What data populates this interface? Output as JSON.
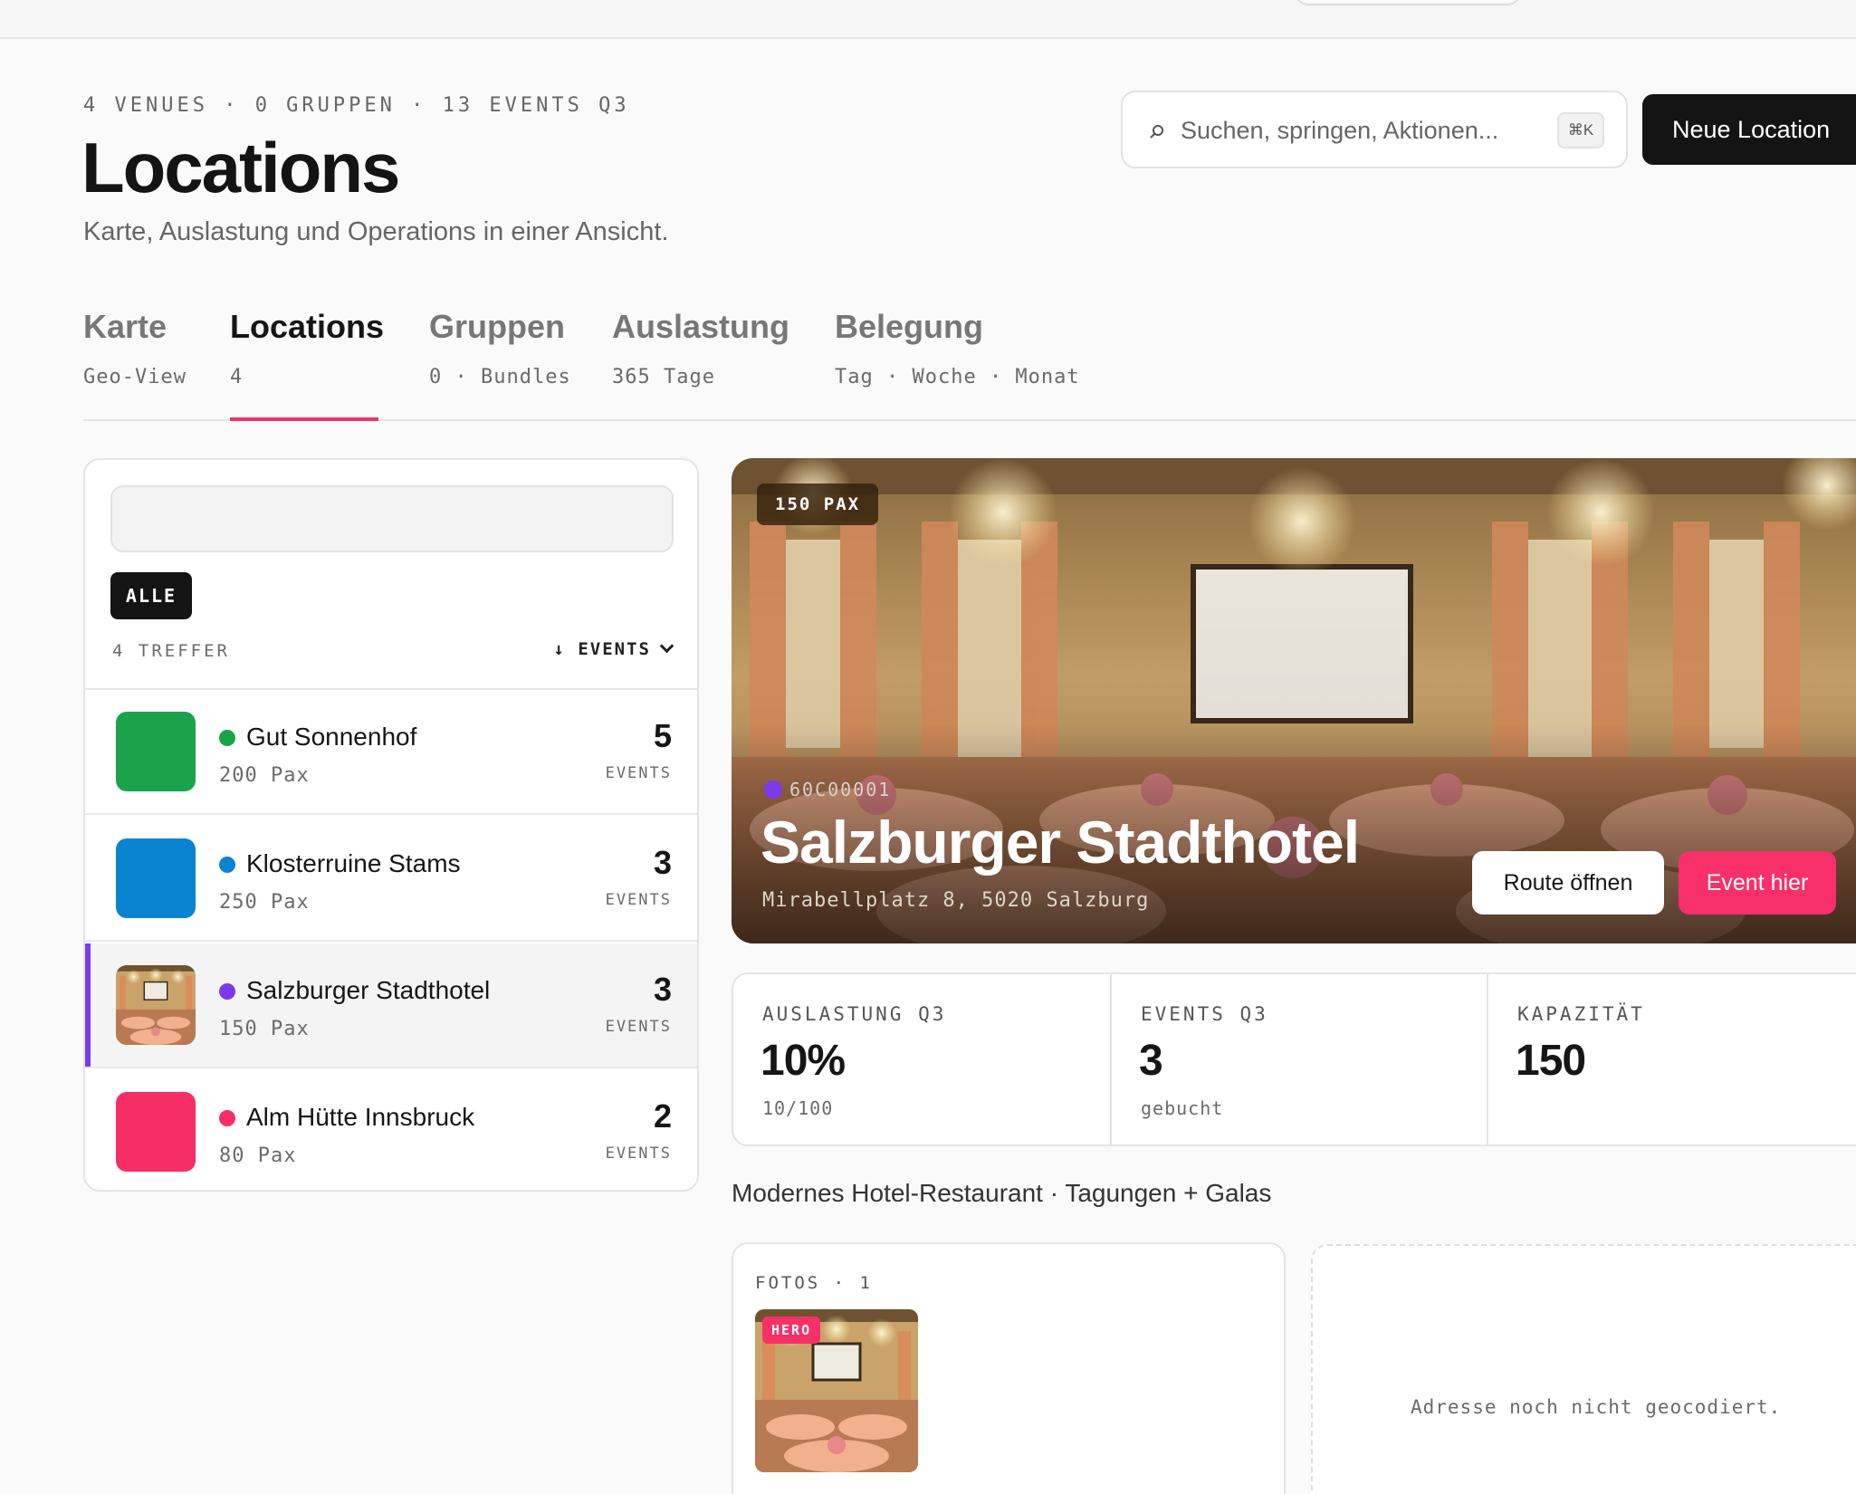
{
  "header": {
    "stats": "4 VENUES · 0 GRUPPEN · 13 EVENTS Q3",
    "title": "Locations",
    "subtitle": "Karte, Auslastung und Operations in einer Ansicht.",
    "search_placeholder": "Suchen, springen, Aktionen...",
    "search_shortcut": "⌘K",
    "new_location_label": "Neue Location"
  },
  "tabs": [
    {
      "label": "Karte",
      "sub": "Geo-View",
      "active": false
    },
    {
      "label": "Locations",
      "sub": "4",
      "active": true
    },
    {
      "label": "Gruppen",
      "sub": "0 · Bundles",
      "active": false
    },
    {
      "label": "Auslastung",
      "sub": "365 Tage",
      "active": false
    },
    {
      "label": "Belegung",
      "sub": "Tag · Woche · Monat",
      "active": false
    }
  ],
  "list": {
    "filter_chip": "ALLE",
    "hits": "4 TREFFER",
    "sort_label": "↓ EVENTS",
    "events_label": "EVENTS",
    "venues": [
      {
        "name": "Gut Sonnenhof",
        "pax": "200 Pax",
        "events": "5",
        "color": "#1aa34a",
        "selected": false
      },
      {
        "name": "Klosterruine Stams",
        "pax": "250 Pax",
        "events": "3",
        "color": "#0a84d0",
        "selected": false
      },
      {
        "name": "Salzburger Stadthotel",
        "pax": "150 Pax",
        "events": "3",
        "color": "#7c3aed",
        "selected": true
      },
      {
        "name": "Alm Hütte Innsbruck",
        "pax": "80 Pax",
        "events": "2",
        "color": "#f72d66",
        "selected": false
      }
    ]
  },
  "detail": {
    "pax_badge": "150 PAX",
    "code": "60C00001",
    "title": "Salzburger Stadthotel",
    "address": "Mirabellplatz 8, 5020 Salzburg",
    "route_label": "Route öffnen",
    "event_label": "Event hier",
    "kpis": [
      {
        "label": "AUSLASTUNG Q3",
        "value": "10%",
        "sub": "10/100"
      },
      {
        "label": "EVENTS Q3",
        "value": "3",
        "sub": "gebucht"
      },
      {
        "label": "KAPAZITÄT",
        "value": "150",
        "sub": ""
      }
    ],
    "description": "Modernes Hotel-Restaurant · Tagungen + Galas",
    "photos_label": "FOTOS · 1",
    "hero_badge": "HERO",
    "map_message": "Adresse noch nicht geocodiert."
  },
  "colors": {
    "accent": "#f72d66",
    "dark": "#141414",
    "selected_marker": "#7c3aed"
  }
}
